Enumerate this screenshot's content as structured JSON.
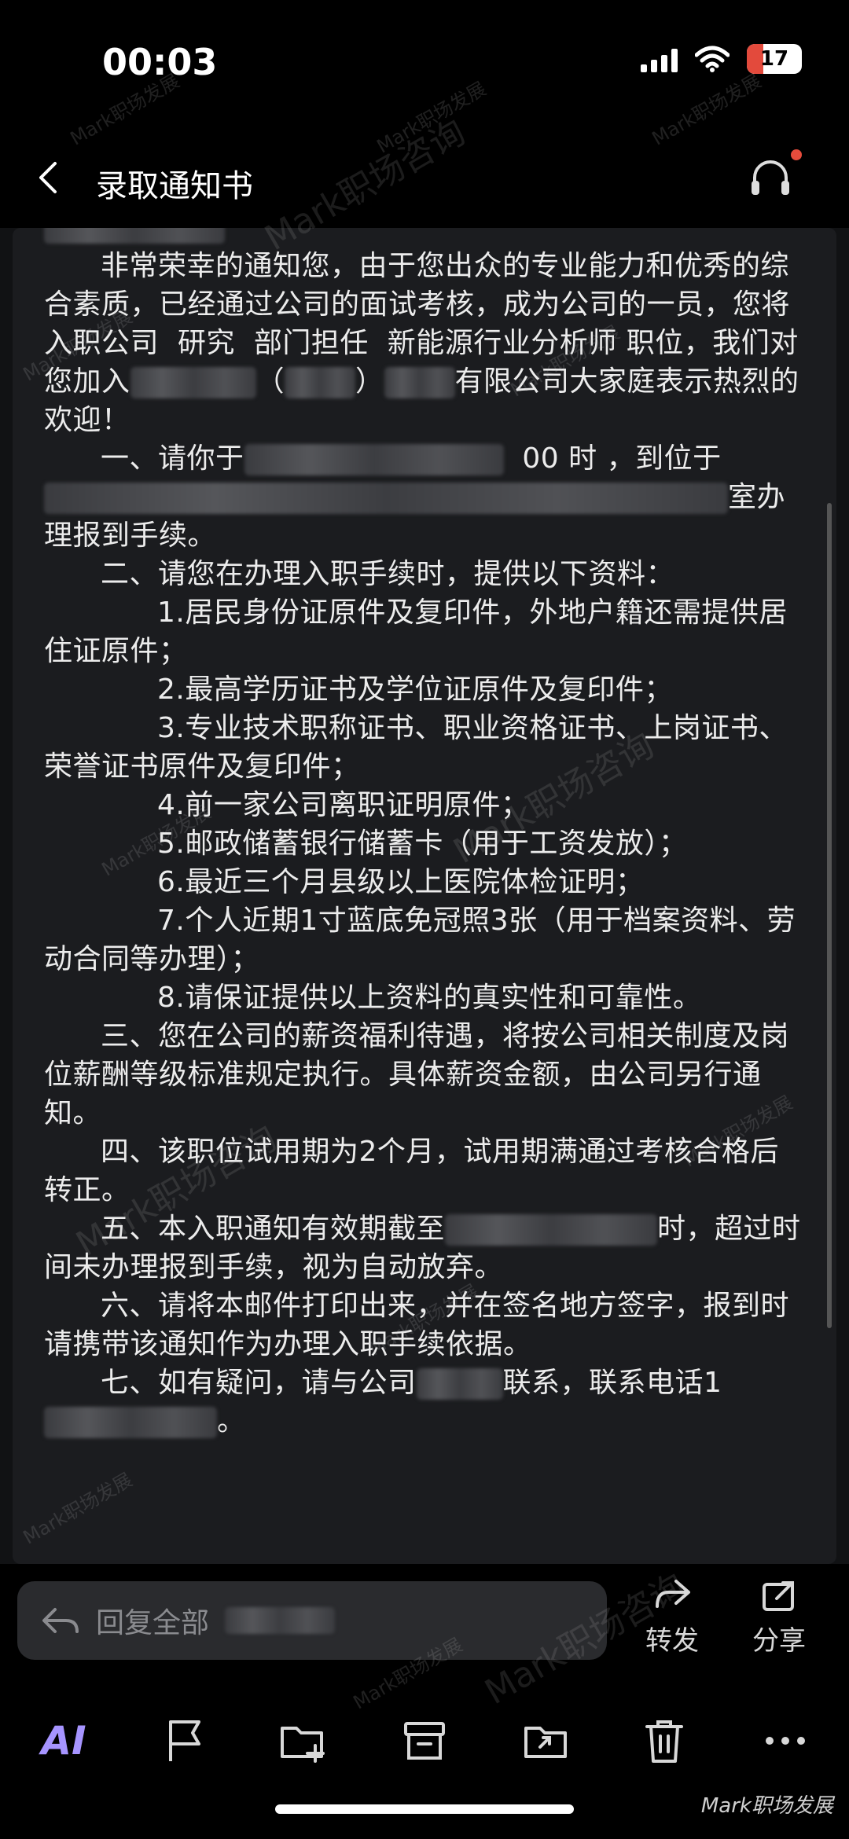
{
  "status": {
    "time": "00:03",
    "battery": "17"
  },
  "nav": {
    "title": "录取通知书"
  },
  "email": {
    "p1a": "非常荣幸的通知您，由于您出众的专业能力和优秀的综合素质，已经通过公司的面试考核，成为公司的一员，您将入职公司",
    "p1b": "研究",
    "p1c": "部门担任",
    "p1d": "新能源行业分析师",
    "p1e": "职位，我们对您加入",
    "p1f": "（",
    "p1g": "）",
    "p1h": "有限公司大家庭表示热烈的欢迎！",
    "p2a": "一、请你于",
    "p2b": "00 时 ，到位于",
    "p2c": "室办理报到手续。",
    "p3": "二、请您在办理入职手续时，提供以下资料：",
    "items": [
      "1.居民身份证原件及复印件，外地户籍还需提供居住证原件；",
      "2.最高学历证书及学位证原件及复印件；",
      "3.专业技术职称证书、职业资格证书、上岗证书、荣誉证书原件及复印件；",
      "4.前一家公司离职证明原件；",
      "5.邮政储蓄银行储蓄卡（用于工资发放）；",
      "6.最近三个月县级以上医院体检证明；",
      "7.个人近期1寸蓝底免冠照3张（用于档案资料、劳动合同等办理）；",
      "8.请保证提供以上资料的真实性和可靠性。"
    ],
    "p4": "三、您在公司的薪资福利待遇，将按公司相关制度及岗位薪酬等级标准规定执行。具体薪资金额，由公司另行通知。",
    "p5": "四、该职位试用期为2个月，试用期满通过考核合格后转正。",
    "p6a": "五、本入职通知有效期截至",
    "p6b": "时，超过时间未办理报到手续，视为自动放弃。",
    "p7": "六、请将本邮件打印出来，并在签名地方签字，报到时请携带该通知作为办理入职手续依据。",
    "p8a": "七、如有疑问，请与公司",
    "p8b": "联系，联系电话1",
    "p8c": "。"
  },
  "reply": {
    "placeholder": "回复全部",
    "forward_label": "转发",
    "share_label": "分享"
  },
  "toolbar": {
    "ai_label": "AI"
  },
  "watermark": {
    "text": "Mark职场发展",
    "text2": "Mark职场咨询"
  },
  "icons": {
    "back": "chevron-left-icon",
    "headset": "headset-icon",
    "reply": "reply-all-icon",
    "forward": "forward-icon",
    "share": "share-icon",
    "flag": "flag-icon",
    "add_to_folder": "folder-add-icon",
    "archive": "archive-icon",
    "move": "move-icon",
    "trash": "trash-icon",
    "more": "more-icon"
  }
}
